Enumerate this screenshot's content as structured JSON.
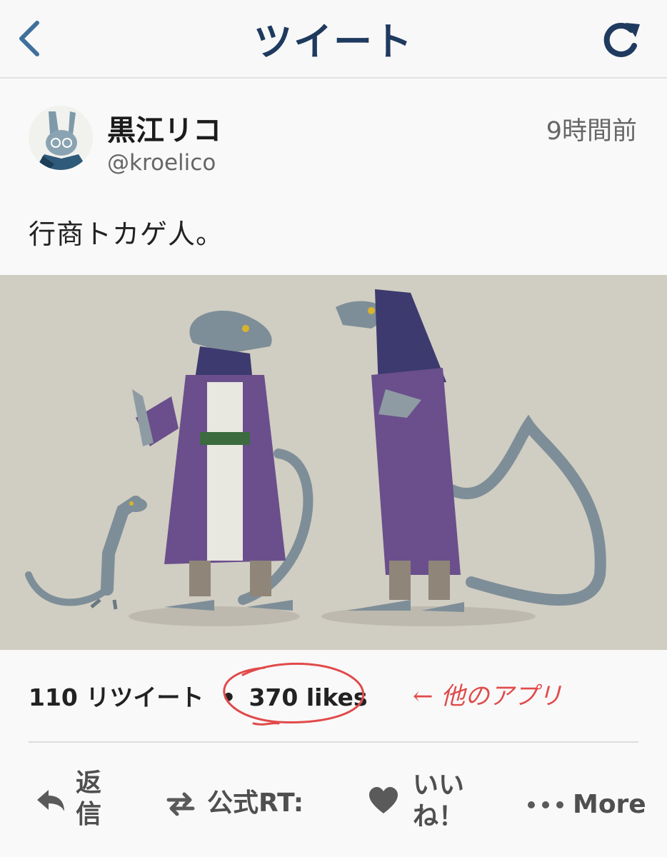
{
  "nav": {
    "title": "ツイート"
  },
  "tweet": {
    "display_name": "黒江リコ",
    "handle": "@kroelico",
    "timestamp": "9時間前",
    "text": "行商トカゲ人。"
  },
  "stats": {
    "retweets": "110 リツイート",
    "separator": "•",
    "likes": "370 likes",
    "annotation": "← 他のアプリ"
  },
  "actions": {
    "reply_label": "返信",
    "retweet_label": "公式RT:",
    "like_label": "いいね！",
    "more_label": "More"
  },
  "colors": {
    "nav_accent": "#1f3a5f",
    "back_icon": "#3f6f9c",
    "annotation": "#e14a4a",
    "media_bg": "#d0cdc2"
  }
}
